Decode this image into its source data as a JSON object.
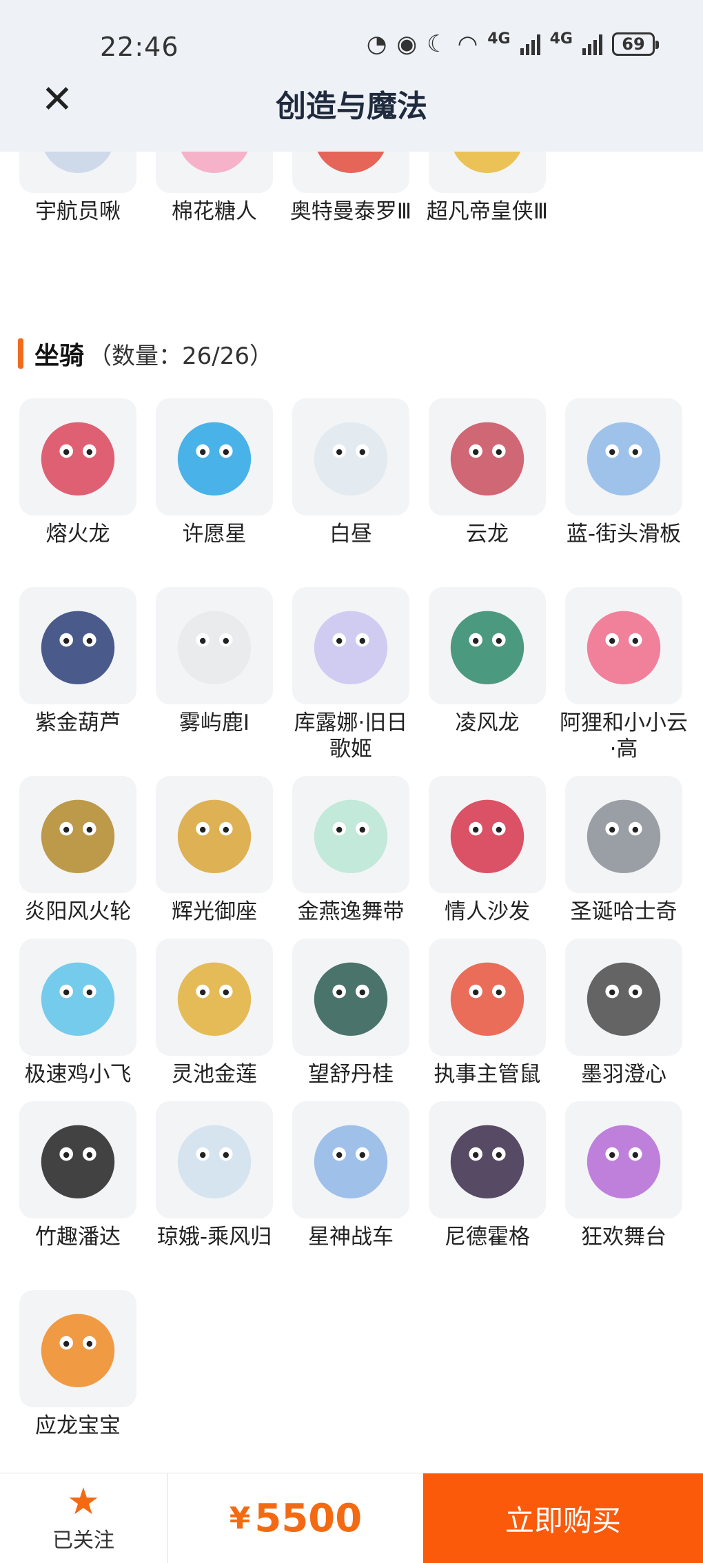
{
  "status_bar": {
    "time": "22:46",
    "net1": "4G",
    "net2": "4G",
    "battery": "69"
  },
  "header": {
    "close_icon": "close-icon",
    "title": "创造与魔法"
  },
  "top_items": [
    {
      "label": "宇航员啾",
      "icon": "astronaut-icon",
      "color": "#c7d3e8"
    },
    {
      "label": "棉花糖人",
      "icon": "marshmallow-icon",
      "color": "#f5a6c0"
    },
    {
      "label": "奥特曼泰罗Ⅲ",
      "icon": "ultraman-icon",
      "color": "#e24c3c"
    },
    {
      "label": "超凡帝皇侠Ⅲ",
      "icon": "armor-hero-icon",
      "color": "#e8b93a"
    }
  ],
  "section": {
    "title": "坐骑",
    "count": "（数量：26/26）"
  },
  "mounts": [
    {
      "label": "熔火龙",
      "icon": "fire-dragon-icon",
      "color": "#d9455a"
    },
    {
      "label": "许愿星",
      "icon": "wish-star-icon",
      "color": "#2aa7e6"
    },
    {
      "label": "白昼",
      "icon": "white-cat-icon",
      "color": "#dfe7ee"
    },
    {
      "label": "云龙",
      "icon": "cloud-dragon-icon",
      "color": "#c84d5e"
    },
    {
      "label": "蓝-街头滑板",
      "icon": "skateboard-icon",
      "color": "#8fb9e8"
    },
    {
      "label": "紫金葫芦",
      "icon": "gourd-icon",
      "color": "#2b3e78"
    },
    {
      "label": "雾屿鹿Ⅰ",
      "icon": "deer-icon",
      "color": "#e6e9ea"
    },
    {
      "label": "库露娜·旧日歌姬",
      "icon": "diva-icon",
      "color": "#c9c4f0"
    },
    {
      "label": "凌风龙",
      "icon": "wind-dragon-icon",
      "color": "#2d8a6a"
    },
    {
      "label": "阿狸和小小云·高",
      "icon": "fox-cloud-icon",
      "color": "#f06b8a"
    },
    {
      "label": "炎阳风火轮",
      "icon": "fire-wheel-icon",
      "color": "#b3892c"
    },
    {
      "label": "辉光御座",
      "icon": "throne-icon",
      "color": "#d8a437"
    },
    {
      "label": "金燕逸舞带",
      "icon": "ribbon-icon",
      "color": "#b8e6d4"
    },
    {
      "label": "情人沙发",
      "icon": "sofa-icon",
      "color": "#d6344b"
    },
    {
      "label": "圣诞哈士奇",
      "icon": "husky-icon",
      "color": "#8a8f96"
    },
    {
      "label": "极速鸡小飞",
      "icon": "chick-icon",
      "color": "#5ec3ea"
    },
    {
      "label": "灵池金莲",
      "icon": "lotus-icon",
      "color": "#e0b03a"
    },
    {
      "label": "望舒丹桂",
      "icon": "swing-icon",
      "color": "#2c5c52"
    },
    {
      "label": "执事主管鼠",
      "icon": "butler-mouse-icon",
      "color": "#e8553e"
    },
    {
      "label": "墨羽澄心",
      "icon": "feather-blade-icon",
      "color": "#4a4a4a"
    },
    {
      "label": "竹趣潘达",
      "icon": "panda-icon",
      "color": "#222222"
    },
    {
      "label": "琼娥-乘风归",
      "icon": "fairy-icon",
      "color": "#cfe1ec"
    },
    {
      "label": "星神战车",
      "icon": "star-horse-icon",
      "color": "#8fb6e6"
    },
    {
      "label": "尼德霍格",
      "icon": "dark-dragon-icon",
      "color": "#3a2c4a"
    },
    {
      "label": "狂欢舞台",
      "icon": "stage-icon",
      "color": "#b46bd6"
    },
    {
      "label": "应龙宝宝",
      "icon": "baby-dragon-icon",
      "color": "#f08a24"
    }
  ],
  "bottom": {
    "follow_icon": "star-icon",
    "follow_label": "已关注",
    "price_symbol": "¥",
    "price_value": "5500",
    "buy_label": "立即购买",
    "accent": "#fb5a0a"
  }
}
